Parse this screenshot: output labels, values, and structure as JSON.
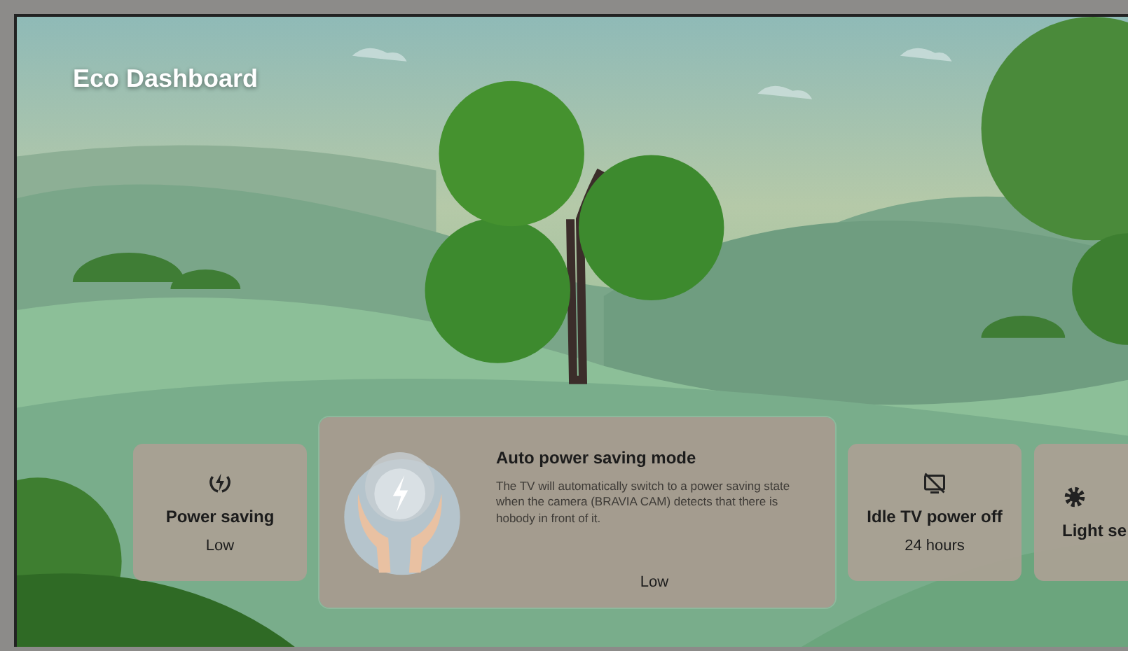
{
  "title": "Eco Dashboard",
  "cards": [
    {
      "kind": "setting",
      "title": "Power saving",
      "value": "Low",
      "selected": false
    },
    {
      "kind": "mode",
      "title": "Auto power saving mode",
      "description": "The TV will automatically switch to a power saving state when the camera (BRAVIA CAM) detects that there is hobody in front of it.",
      "value": "Low",
      "selected": true
    },
    {
      "kind": "setting",
      "title": "Idle TV power off",
      "value": "24 hours",
      "selected": false
    },
    {
      "kind": "setting",
      "title": "Light se",
      "selected": false
    }
  ]
}
